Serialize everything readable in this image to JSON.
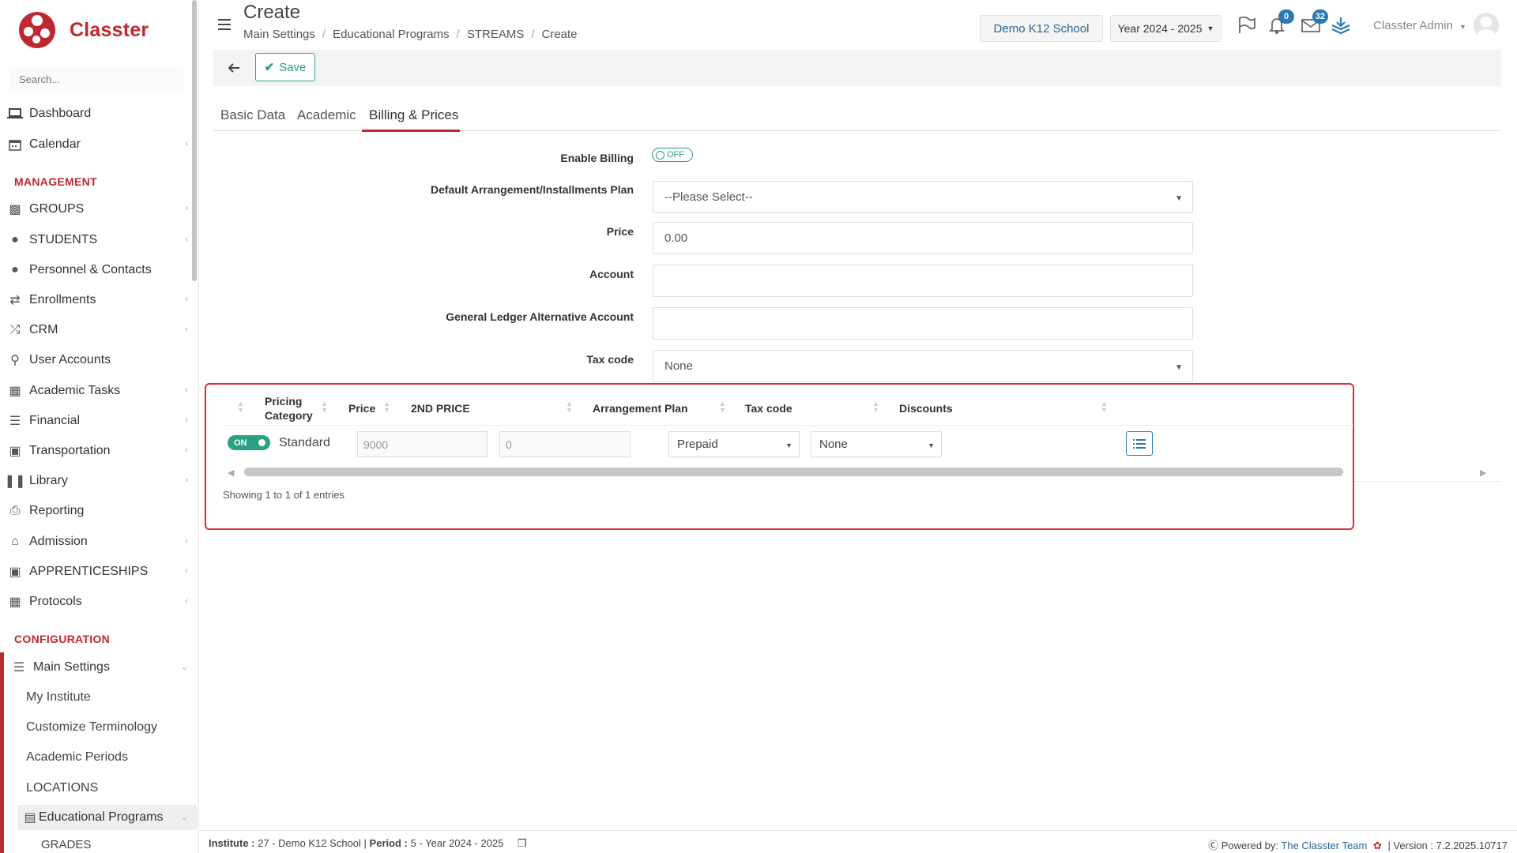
{
  "app": {
    "name": "Classter"
  },
  "sidebar": {
    "search_placeholder": "Search...",
    "items_top": [
      {
        "label": "Dashboard",
        "icon": "laptop-icon"
      },
      {
        "label": "Calendar",
        "icon": "calendar-icon"
      }
    ],
    "section_management": "MANAGEMENT",
    "items_management": [
      {
        "label": "GROUPS",
        "icon": "groups-icon"
      },
      {
        "label": "STUDENTS",
        "icon": "students-icon"
      },
      {
        "label": "Personnel & Contacts",
        "icon": "personnel-icon"
      },
      {
        "label": "Enrollments",
        "icon": "exchange-icon"
      },
      {
        "label": "CRM",
        "icon": "crm-icon"
      },
      {
        "label": "User Accounts",
        "icon": "key-icon"
      },
      {
        "label": "Academic Tasks",
        "icon": "tasks-icon"
      },
      {
        "label": "Financial",
        "icon": "coins-icon"
      },
      {
        "label": "Transportation",
        "icon": "bus-icon"
      },
      {
        "label": "Library",
        "icon": "library-icon"
      },
      {
        "label": "Reporting",
        "icon": "print-icon"
      },
      {
        "label": "Admission",
        "icon": "institution-icon"
      },
      {
        "label": "APPRENTICESHIPS",
        "icon": "box-icon"
      },
      {
        "label": "Protocols",
        "icon": "protocols-icon"
      }
    ],
    "section_configuration": "CONFIGURATION",
    "main_settings": "Main Settings",
    "config_sub": [
      "My Institute",
      "Customize Terminology",
      "Academic Periods",
      "LOCATIONS"
    ],
    "educational_programs": "Educational Programs",
    "grades": "GRADES"
  },
  "header": {
    "title": "Create",
    "breadcrumb": [
      "Main Settings",
      "Educational Programs",
      "STREAMS",
      "Create"
    ],
    "school": "Demo K12 School",
    "year": "Year 2024 - 2025",
    "notifications_count": "0",
    "messages_count": "32",
    "user": "Classter Admin"
  },
  "toolbar": {
    "save_label": "Save"
  },
  "tabs": [
    "Basic Data",
    "Academic",
    "Billing & Prices"
  ],
  "form": {
    "enable_billing_label": "Enable Billing",
    "enable_billing_value": "OFF",
    "arrangement_label": "Default Arrangement/Installments Plan",
    "arrangement_value": "--Please Select--",
    "price_label": "Price",
    "price_value": "0.00",
    "account_label": "Account",
    "account_value": "",
    "gl_label": "General Ledger Alternative Account",
    "gl_value": "",
    "tax_label": "Tax code",
    "tax_value": "None"
  },
  "table": {
    "headers": [
      "Pricing Category",
      "Price",
      "2ND PRICE",
      "Arrangement Plan",
      "Tax code",
      "Discounts"
    ],
    "row": {
      "active": "ON",
      "category": "Standard",
      "price_placeholder": "9000",
      "second_price_placeholder": "0",
      "arrangement": "Prepaid",
      "tax": "None"
    },
    "info": "Showing 1 to 1 of 1 entries"
  },
  "footer": {
    "institute_label": "Institute :",
    "institute_value": "27 - Demo K12 School",
    "period_label": "Period :",
    "period_value": "5 - Year 2024 - 2025",
    "powered_label": "Powered by:",
    "powered_link": "The Classter Team",
    "version": "| Version : 7.2.2025.10717"
  },
  "colors": {
    "brand": "#c0282f",
    "accent": "#2aa084",
    "link": "#2a6496",
    "highlight_border": "#e02a3a"
  }
}
